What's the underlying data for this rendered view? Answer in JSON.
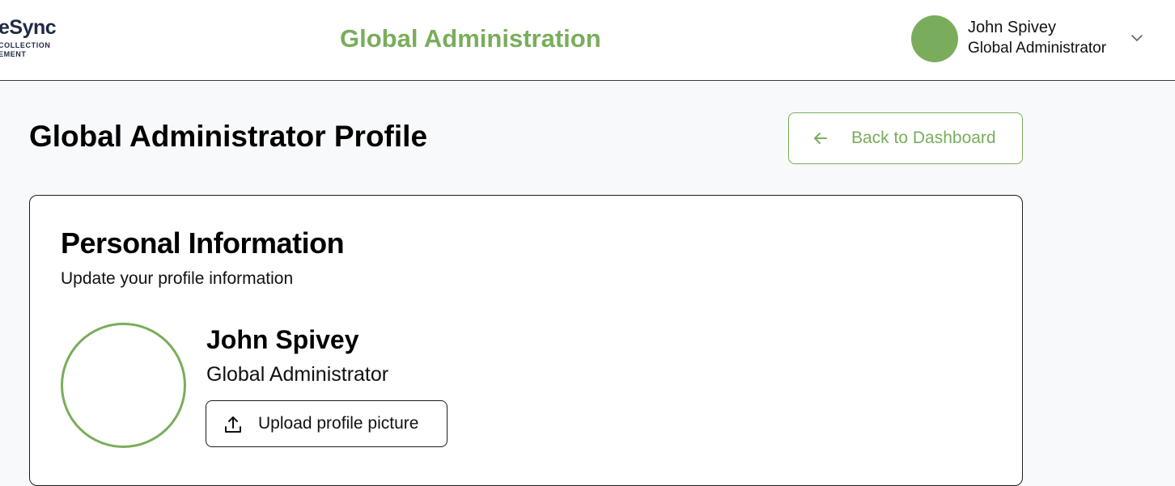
{
  "header": {
    "logo": {
      "main_text": "eSync",
      "sub_line_1": "COLLECTION",
      "sub_line_2": "EMENT"
    },
    "app_title": "Global Administration",
    "user": {
      "name": "John Spivey",
      "role": "Global Administrator"
    }
  },
  "page": {
    "title": "Global Administrator Profile",
    "back_button_label": "Back to Dashboard"
  },
  "personal_info_card": {
    "title": "Personal Information",
    "subtitle": "Update your profile information",
    "profile": {
      "name": "John Spivey",
      "role": "Global Administrator"
    },
    "upload_button_label": "Upload profile picture"
  },
  "colors": {
    "accent": "#79ad5b",
    "logo_text": "#1f2a44",
    "page_background": "#f8f9fa"
  },
  "icons": {
    "user_menu": "chevron-down-icon",
    "back": "arrow-left-icon",
    "upload": "upload-icon"
  }
}
